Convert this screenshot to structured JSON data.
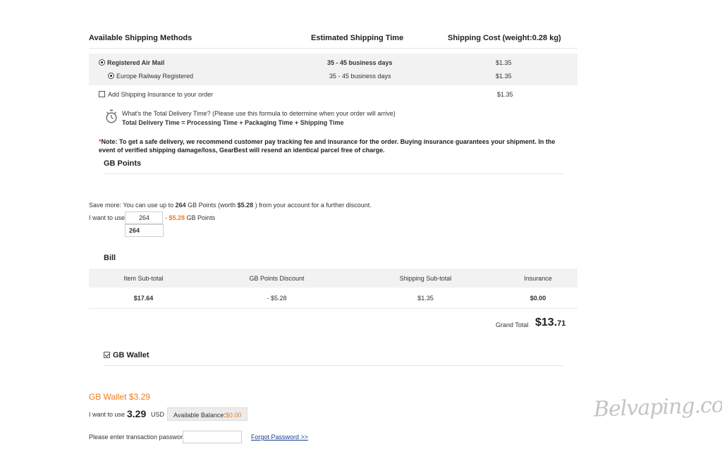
{
  "shipping": {
    "col_method": "Available Shipping Methods",
    "col_time": "Estimated Shipping Time",
    "col_cost": "Shipping Cost (weight:0.28 kg)",
    "rows": [
      {
        "label": "Registered Air Mail",
        "time": "35 - 45 business days",
        "cost": "$1.35"
      },
      {
        "label": "Europe Railway Registered",
        "time": "35 - 45 business days",
        "cost": "$1.35"
      }
    ],
    "insurance_label": "Add Shipping Insurance to your order",
    "insurance_cost": "$1.35",
    "delivery_question": "What's the Total Delivery Time? (Please use this formula to determine when your order will arrive)",
    "delivery_formula": "Total Delivery Time = Processing Time + Packaging Time + Shipping Time",
    "note_star": "*",
    "note_text": "Note: To get a safe delivery, we recommend customer pay tracking fee and insurance for the order. Buying insurance guarantees your shipment. In the event of verified shipping damage/loss, GearBest will resend an identical parcel free of charge."
  },
  "points": {
    "title": "GB Points",
    "save_more_prefix": "Save more: You can use up to ",
    "max_points": "264",
    "save_more_mid": " GB Points (worth ",
    "worth": "$5.28",
    "save_more_suffix": " ) from your account for a further discount.",
    "want_label": "I want to use",
    "input_value": "264",
    "discount": "- $5.28",
    "unit": "GB Points",
    "suggestion": "264"
  },
  "bill": {
    "title": "Bill",
    "headers": [
      "Item Sub-total",
      "GB Points Discount",
      "Shipping Sub-total",
      "Insurance"
    ],
    "values": [
      "$17.64",
      "- $5.28",
      "$1.35",
      "$0.00"
    ],
    "grand_label": "Grand Total",
    "grand_main": "$13.",
    "grand_cents": "71"
  },
  "wallet": {
    "title": "GB Wallet",
    "amount_title": "GB Wallet $3.29",
    "want_label": "I want to use",
    "amount": "3.29",
    "currency": "USD",
    "balance_label": "Available Balance:",
    "balance_value": "$0.00",
    "password_label": "Please enter transaction password",
    "password_value": "",
    "forgot": "Forgot Password >>"
  },
  "watermark": "Belvaping.com",
  "colors": {
    "accent": "#f07c1c",
    "band": "#f2f2f2",
    "link": "#1a3f8f"
  }
}
